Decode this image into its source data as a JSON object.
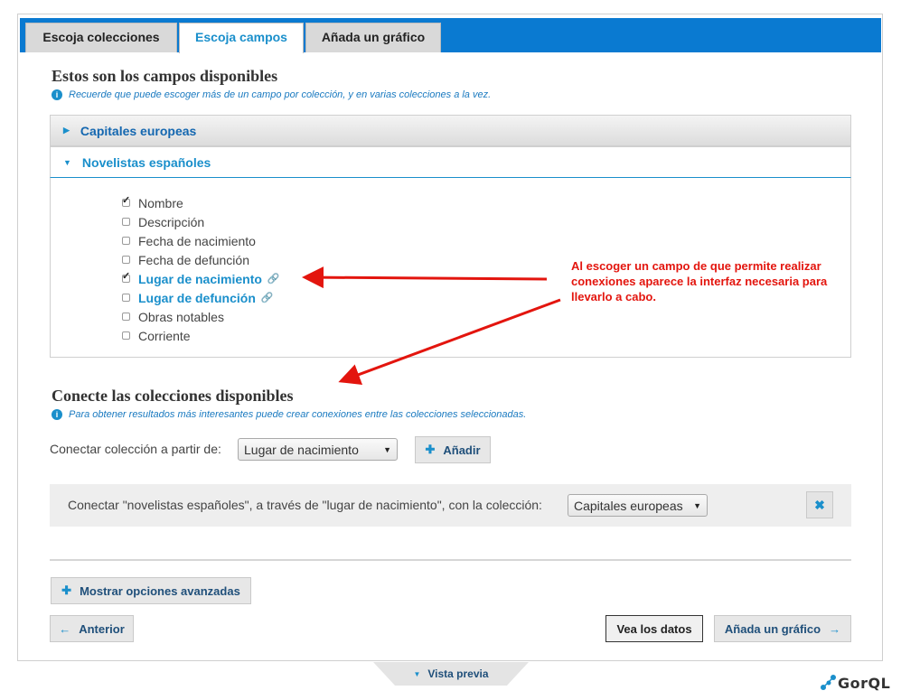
{
  "tabs": [
    {
      "label": "Escoja colecciones"
    },
    {
      "label": "Escoja campos"
    },
    {
      "label": "Añada un gráfico"
    }
  ],
  "fields_section": {
    "title": "Estos son los campos disponibles",
    "info": "Recuerde que puede escoger más de un campo por colección, y en varias colecciones a la vez."
  },
  "collections": [
    {
      "name": "Capitales europeas",
      "expanded": false
    },
    {
      "name": "Novelistas españoles",
      "expanded": true
    }
  ],
  "fields": [
    {
      "label": "Nombre",
      "checked": true,
      "linkable": false
    },
    {
      "label": "Descripción",
      "checked": false,
      "linkable": false
    },
    {
      "label": "Fecha de nacimiento",
      "checked": false,
      "linkable": false
    },
    {
      "label": "Fecha de defunción",
      "checked": false,
      "linkable": false
    },
    {
      "label": "Lugar de nacimiento",
      "checked": true,
      "linkable": true
    },
    {
      "label": "Lugar de defunción",
      "checked": false,
      "linkable": true
    },
    {
      "label": "Obras notables",
      "checked": false,
      "linkable": false
    },
    {
      "label": "Corriente",
      "checked": false,
      "linkable": false
    }
  ],
  "annotation": "Al escoger un campo de que permite realizar conexiones aparece la interfaz necesaria para llevarlo a cabo.",
  "connect_section": {
    "title": "Conecte las colecciones disponibles",
    "info": "Para obtener resultados más interesantes puede crear conexiones entre las colecciones seleccionadas.",
    "from_label": "Conectar colección a partir de:",
    "from_value": "Lugar de nacimiento",
    "add_label": "Añadir",
    "connection_text": "Conectar \"novelistas españoles\", a través de \"lugar de nacimiento\", con la colección:",
    "connection_value": "Capitales europeas"
  },
  "buttons": {
    "advanced": "Mostrar opciones avanzadas",
    "previous": "Anterior",
    "view_data": "Vea los datos",
    "add_chart": "Añada un gráfico"
  },
  "preview_label": "Vista previa",
  "logo_text": "GorQL",
  "colors": {
    "accent": "#1a8fcb",
    "tabbar": "#0a7ad1",
    "annotation": "#e3150e"
  }
}
